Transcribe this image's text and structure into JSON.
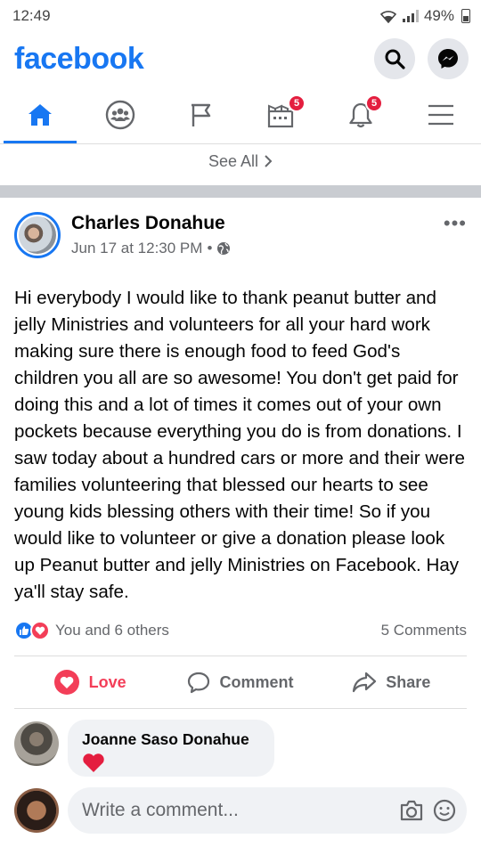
{
  "status_bar": {
    "time": "12:49",
    "battery": "49%"
  },
  "header": {
    "logo": "facebook",
    "search_icon": "search-icon",
    "messenger_icon": "messenger-icon"
  },
  "nav": {
    "tabs": [
      {
        "name": "home",
        "icon": "home-icon",
        "badge": ""
      },
      {
        "name": "groups",
        "icon": "groups-icon",
        "badge": ""
      },
      {
        "name": "pages",
        "icon": "flag-icon",
        "badge": ""
      },
      {
        "name": "marketplace",
        "icon": "marketplace-icon",
        "badge": "5"
      },
      {
        "name": "notifications",
        "icon": "bell-icon",
        "badge": "5"
      },
      {
        "name": "menu",
        "icon": "menu-icon",
        "badge": ""
      }
    ],
    "accent": "#1877f2"
  },
  "see_all": "See All",
  "post": {
    "author": "Charles Donahue",
    "timestamp": "Jun 17 at 12:30 PM",
    "separator": "•",
    "text": "Hi everybody I would like to thank peanut butter and jelly Ministries and volunteers for all your hard work making sure there is enough food to feed God's children you all are so awesome! You don't get paid for doing this and a lot of times it comes out of your own pockets because everything you do is from donations. I saw today about a hundred cars or more and their were families volunteering that blessed our hearts to see young kids blessing others with their time! So if you would like to volunteer or give a donation please look up Peanut butter and jelly Ministries on Facebook. Hay ya'll stay safe.",
    "reactions_text": "You and 6 others",
    "comments_count": "5 Comments"
  },
  "actions": {
    "love": "Love",
    "comment": "Comment",
    "share": "Share"
  },
  "comment": {
    "author": "Joanne Saso Donahue",
    "content_icon": "heart-icon"
  },
  "composer": {
    "placeholder": "Write a comment..."
  },
  "colors": {
    "brand": "#1877f2",
    "love": "#f33e58",
    "badge": "#e41e3f"
  }
}
